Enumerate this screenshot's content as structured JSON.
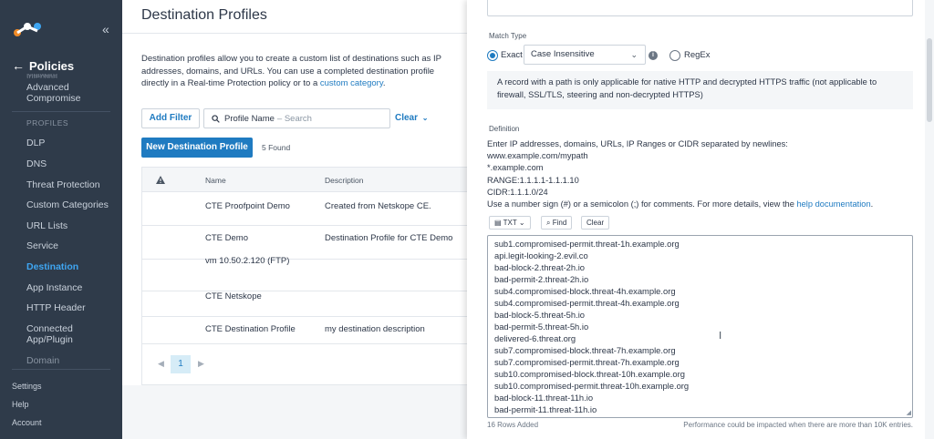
{
  "sidebar": {
    "section_title": "Policies",
    "faded_item": "Malware Infection",
    "items_top": [
      {
        "label": "Advanced Compromise"
      }
    ],
    "section_label": "PROFILES",
    "profiles": [
      {
        "label": "DLP"
      },
      {
        "label": "DNS"
      },
      {
        "label": "Threat Protection"
      },
      {
        "label": "Custom Categories"
      },
      {
        "label": "URL Lists"
      },
      {
        "label": "Service"
      },
      {
        "label": "Destination"
      },
      {
        "label": "App Instance"
      },
      {
        "label": "HTTP Header"
      },
      {
        "label": "Connected App/Plugin"
      },
      {
        "label": "Domain"
      }
    ],
    "bottom": [
      {
        "label": "Settings"
      },
      {
        "label": "Help"
      },
      {
        "label": "Account"
      }
    ]
  },
  "main": {
    "title": "Destination Profiles",
    "description_parts": {
      "text": "Destination profiles allow you to create a custom list of destinations such as IP addresses, domains, and URLs. You can use a completed destination profile directly in a Real-time Protection policy or to a ",
      "link": "custom category",
      "end": "."
    },
    "add_filter": "Add Filter",
    "search": {
      "field": "Profile Name",
      "placeholder": "– Search"
    },
    "clear": "Clear",
    "new_button": "New Destination Profile",
    "found": "5 Found",
    "columns": {
      "name": "Name",
      "description": "Description"
    },
    "rows": [
      {
        "name": "CTE Proofpoint Demo",
        "description": "Created from Netskope CE."
      },
      {
        "name": "CTE Demo",
        "description": "Destination Profile for CTE Demo"
      },
      {
        "name": "vm 10.50.2.120 (FTP)",
        "description": ""
      },
      {
        "name": "CTE Netskope",
        "description": ""
      },
      {
        "name": "CTE Destination Profile",
        "description": "my destination description"
      }
    ],
    "page": "1"
  },
  "drawer": {
    "match_type_label": "Match Type",
    "exact_label": "Exact",
    "case_select": "Case Insensitive",
    "regex_label": "RegEx",
    "note": "A record with a path is only applicable for native HTTP and decrypted HTTPS traffic (not applicable to firewall, SSL/TLS, steering and non-decrypted HTTPS)",
    "definition_label": "Definition",
    "definition_lines": [
      "Enter IP addresses, domains, URLs, IP Ranges or CIDR separated by newlines:",
      "www.example.com/mypath",
      "*.example.com",
      "RANGE:1.1.1.1-1.1.1.10",
      "CIDR:1.1.1.0/24"
    ],
    "comment_text": "Use a number sign (#) or a semicolon (;) for comments. For more details, view the ",
    "help_link": "help documentation",
    "comment_end": ".",
    "tool_txt": "TXT",
    "tool_find": "Find",
    "tool_clear": "Clear",
    "entries": [
      "sub1.compromised-permit.threat-1h.example.org",
      "api.legit-looking-2.evil.co",
      "bad-block-2.threat-2h.io",
      "bad-permit-2.threat-2h.io",
      "sub4.compromised-block.threat-4h.example.org",
      "sub4.compromised-permit.threat-4h.example.org",
      "bad-block-5.threat-5h.io",
      "bad-permit-5.threat-5h.io",
      "delivered-6.threat.org",
      "sub7.compromised-block.threat-7h.example.org",
      "sub7.compromised-permit.threat-7h.example.org",
      "sub10.compromised-block.threat-10h.example.org",
      "sub10.compromised-permit.threat-10h.example.org",
      "bad-block-11.threat-11h.io",
      "bad-permit-11.threat-11h.io"
    ],
    "rows_added": "16 Rows Added",
    "perf_note": "Performance could be impacted when there are more than 10K entries."
  },
  "colors": {
    "accent": "#1f7bc1",
    "sidebar_bg": "#2f3b4a",
    "active_nav": "#3fa6f2"
  }
}
